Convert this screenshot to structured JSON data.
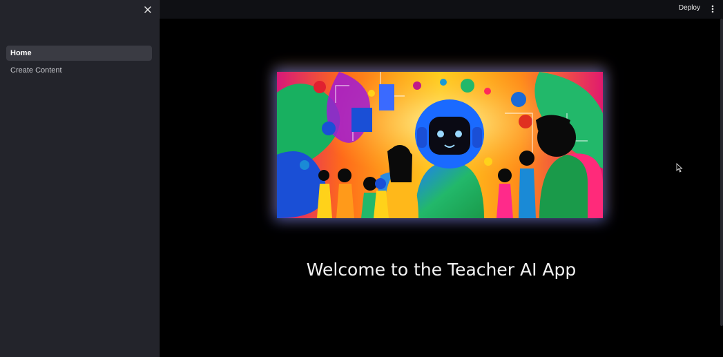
{
  "sidebar": {
    "close_icon": "close-icon",
    "items": [
      {
        "label": "Home",
        "active": true
      },
      {
        "label": "Create Content",
        "active": false
      }
    ]
  },
  "header": {
    "deploy_label": "Deploy",
    "menu_icon": "vertical-dots-icon"
  },
  "main": {
    "hero_image": "colorful-robot-with-children-and-adults-illustration",
    "welcome_text": "Welcome to the Teacher AI App"
  },
  "colors": {
    "sidebar_bg": "#23242b",
    "main_bg": "#000000",
    "active_item_bg": "#3a3b43"
  }
}
